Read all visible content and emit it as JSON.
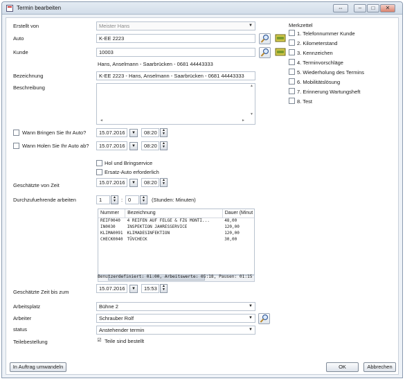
{
  "window": {
    "title": "Termin bearbeiten"
  },
  "form": {
    "erstellt_von": {
      "label": "Erstellt von",
      "value": "Meister Hans"
    },
    "auto": {
      "label": "Auto",
      "value": "K-EE 2223"
    },
    "kunde": {
      "label": "Kunde",
      "value": "10003",
      "info": "Hans, Anselmann - Saarbrücken - 0681 44443333"
    },
    "bezeichnung": {
      "label": "Bezeichnung",
      "value": "K-EE 2223 - Hans, Anselmann - Saarbrücken - 0681 44443333"
    },
    "beschreibung": {
      "label": "Beschreibung",
      "value": ""
    },
    "bringen": {
      "label": "Wann Bringen Sie Ihr Auto?",
      "date": "15.07.2016",
      "time": "08:20"
    },
    "holen": {
      "label": "Wann Holen Sie Ihr Auto ab?",
      "date": "15.07.2016",
      "time": "08:20"
    },
    "hol_bring": {
      "label": "Hol und Bringservice"
    },
    "ersatz": {
      "label": "Ersatz-Auto erforderlich"
    },
    "geschaetzte_von": {
      "label": "Geschätzte von Zeit",
      "date": "15.07.2016",
      "time": "08:20"
    },
    "arbeiten": {
      "label": "Durchzufuehrende arbeiten",
      "hours": "1",
      "minutes": "0",
      "separator": ":",
      "unit": "(Stunden: Minuten)"
    },
    "geschaetzte_bis": {
      "label": "Geschätzte Zeit bis zum",
      "date": "15.07.2016",
      "time": "15:53"
    },
    "arbeitsplatz": {
      "label": "Arbeitsplatz",
      "value": "Bühne 2"
    },
    "arbeiter": {
      "label": "Arbeiter",
      "value": "Schrauber Rolf"
    },
    "status": {
      "label": "status",
      "value": "Anstehender termin"
    },
    "teilebestellung": {
      "label": "Teilebestellung",
      "checkbox": "Teile sind bestellt"
    }
  },
  "table": {
    "columns": [
      "Nummer",
      "Bezeichnung",
      "Dauer (Minut"
    ],
    "rows": [
      [
        "REIF0040",
        "4 REIFEN AUF FELGE & FZG MONTI...",
        "48,00"
      ],
      [
        "IN0030",
        "INSPEKTION JAHRESSERVICE",
        "120,00"
      ],
      [
        "KLIMA0091",
        "KLIMADESINFEKTION",
        "120,00"
      ],
      [
        "CHECK0040",
        "TÜVCHECK",
        "30,00"
      ]
    ],
    "summary": "Benutzerdefiniert: 01:00, Arbeitswerte: 05:18, Pausen: 01:15"
  },
  "merkzettel": {
    "title": "Merkzettel",
    "items": [
      "1. Telefonnummer Kunde",
      "2. Kilometerstand",
      "3. Kennzeichen",
      "4. Terminvorschläge",
      "5. Wiederholung des Termins",
      "6. Mobilitätslösung",
      "7. Erinnerung Wartungsheft",
      "8. Test"
    ]
  },
  "buttons": {
    "convert": "In Auftrag umwandeln",
    "ok": "OK",
    "cancel": "Abbrechen"
  },
  "colors": {
    "accent": "#3b79c4",
    "border": "#b8c2cf"
  }
}
